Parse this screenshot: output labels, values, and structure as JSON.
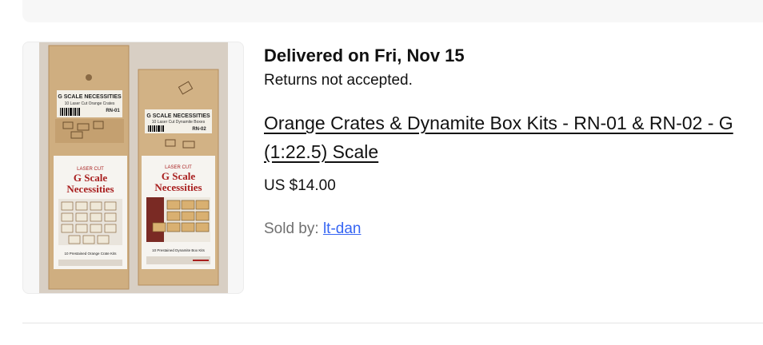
{
  "order": {
    "delivery_status": "Delivered on Fri, Nov 15",
    "returns_policy": "Returns not accepted."
  },
  "item": {
    "title": "Orange Crates & Dynamite Box Kits - RN-01 & RN-02 - G (1:22.5) Scale",
    "price": "US $14.00",
    "image": {
      "left_package": {
        "header": "G SCALE NECESSITIES",
        "subheader": "10 Laser Cut Orange Crates",
        "code": "RN-01",
        "card_top": "LASER CUT",
        "brand_line1": "G Scale",
        "brand_line2": "Necessities",
        "kit_line": "10 Prestained Orange Crate Kits"
      },
      "right_package": {
        "header": "G SCALE NECESSITIES",
        "subheader": "10 Laser Cut Dynamite Boxes",
        "code": "RN-02",
        "card_top": "LASER CUT",
        "brand_line1": "G Scale",
        "brand_line2": "Necessities",
        "kit_line": "10 Prestained Dynamite Box Kits"
      }
    }
  },
  "seller": {
    "label": "Sold by:",
    "name": "lt-dan"
  },
  "colors": {
    "link": "#3665f3",
    "brand_red": "#a81e1e",
    "wood": "#c9a878"
  }
}
